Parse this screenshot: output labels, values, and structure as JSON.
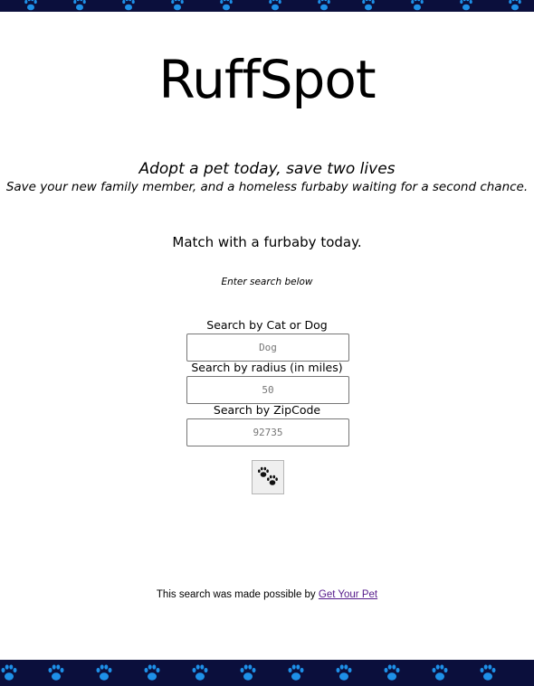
{
  "header": {
    "brand": "RuffSpot",
    "tagline": "Adopt a pet today, save two lives",
    "subtagline": "Save your new family member, and a homeless furbaby waiting for a second chance."
  },
  "search": {
    "heading": "Match with a furbaby today.",
    "instruction": "Enter search below",
    "animal": {
      "label": "Search by Cat or Dog",
      "placeholder": "Dog"
    },
    "radius": {
      "label": "Search by radius (in miles)",
      "placeholder": "50"
    },
    "zipcode": {
      "label": "Search by ZipCode",
      "placeholder": "92735"
    },
    "submit_icon": "paw-prints-icon"
  },
  "footer": {
    "credit_text": "This search was made possible by ",
    "credit_link": "Get Your Pet",
    "link_color": "#551a8b"
  },
  "theme": {
    "band_color": "#0b0f3c",
    "paw_color": "#1e90e8"
  }
}
